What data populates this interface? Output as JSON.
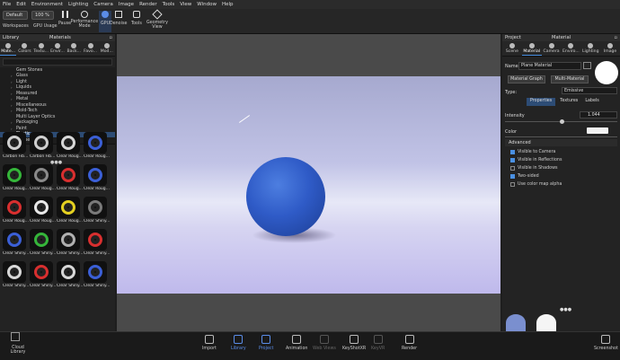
{
  "menu": [
    "File",
    "Edit",
    "Environment",
    "Lighting",
    "Camera",
    "Image",
    "Render",
    "Tools",
    "View",
    "Window",
    "Help"
  ],
  "toolbar": {
    "workspace": "Default",
    "zoom": "100 %",
    "labels": {
      "workspaces": "Workspaces",
      "gpu_usage": "GPU Usage",
      "pause": "Pause",
      "performance": "Performance Mode",
      "gpu": "GPU",
      "denoise": "Denoise",
      "tools": "Tools",
      "geometry": "Geometry View"
    }
  },
  "library": {
    "title": "Library",
    "section": "Materials",
    "tabs": [
      "Mate...",
      "Colors",
      "Textu...",
      "Envir...",
      "Back...",
      "Favo...",
      "Mod..."
    ],
    "tree": [
      {
        "label": "Gem Stones",
        "caret": ""
      },
      {
        "label": "Glass",
        "caret": "›"
      },
      {
        "label": "Light",
        "caret": "›"
      },
      {
        "label": "Liquids",
        "caret": "›"
      },
      {
        "label": "Measured",
        "caret": "›"
      },
      {
        "label": "Metal",
        "caret": "›"
      },
      {
        "label": "Miscellaneous",
        "caret": "›"
      },
      {
        "label": "Mold-Tech",
        "caret": "›"
      },
      {
        "label": "Multi Layer Optics",
        "caret": ""
      },
      {
        "label": "Packaging",
        "caret": "›"
      },
      {
        "label": "Paint",
        "caret": "›"
      },
      {
        "label": "Plastic",
        "caret": "›"
      },
      {
        "label": "Rubber",
        "caret": "›"
      }
    ],
    "selected_tree": "Plastic",
    "materials": [
      {
        "label": "Carbon Fib...",
        "color": "#cfcfcf"
      },
      {
        "label": "Carbon Fib...",
        "color": "#cfcfcf"
      },
      {
        "label": "Clear Roug...",
        "color": "#d8d8d8"
      },
      {
        "label": "Clear Roug...",
        "color": "#3b5fd6"
      },
      {
        "label": "Clear Roug...",
        "color": "#35b53a"
      },
      {
        "label": "Clear Roug...",
        "color": "#8a8a8a"
      },
      {
        "label": "Clear Roug...",
        "color": "#d82f2f"
      },
      {
        "label": "Clear Roug...",
        "color": "#3b5fd6"
      },
      {
        "label": "Clear Roug...",
        "color": "#d82f2f"
      },
      {
        "label": "Clear Roug...",
        "color": "#e8e8e8"
      },
      {
        "label": "Clear Roug...",
        "color": "#e4d021"
      },
      {
        "label": "Clear Shiny...",
        "color": "#7a7a7a"
      },
      {
        "label": "Clear Shiny...",
        "color": "#3b5fd6"
      },
      {
        "label": "Clear Shiny...",
        "color": "#35b53a"
      },
      {
        "label": "Clear Shiny...",
        "color": "#b0b0b0"
      },
      {
        "label": "Clear Shiny...",
        "color": "#d82f2f"
      },
      {
        "label": "Clear Shiny...",
        "color": "#d8d8d8"
      },
      {
        "label": "Clear Shiny...",
        "color": "#d82f2f"
      },
      {
        "label": "Clear Shiny...",
        "color": "#d8d8d8"
      },
      {
        "label": "Clear Shiny...",
        "color": "#3b5fd6"
      }
    ]
  },
  "project": {
    "title": "Project",
    "section": "Material",
    "tabs": [
      "Scene",
      "Material",
      "Camera",
      "Enviro...",
      "Lighting",
      "Image"
    ],
    "name_label": "Name",
    "name_value": "Plane Material",
    "btn_graph": "Material Graph",
    "btn_multi": "Multi-Material",
    "type_label": "Type:",
    "type_value": "Emissive",
    "subtabs": [
      "Properties",
      "Textures",
      "Labels"
    ],
    "intensity_label": "Intensity",
    "intensity_value": "1.044",
    "color_label": "Color",
    "advanced_label": "Advanced",
    "options": [
      {
        "label": "Visible to Camera",
        "checked": true
      },
      {
        "label": "Visible in Reflections",
        "checked": true
      },
      {
        "label": "Visible in Shadows",
        "checked": false
      },
      {
        "label": "Two-sided",
        "checked": true
      },
      {
        "label": "Use color map alpha",
        "checked": false
      }
    ]
  },
  "bottom": {
    "cloud": "Cloud Library",
    "items": [
      "Import",
      "Library",
      "Project",
      "Animation",
      "Web Views",
      "KeyShotXR",
      "KeyVR",
      "Render"
    ],
    "screenshot": "Screenshot"
  },
  "colors": {
    "accent": "#4a90e2",
    "sphere": "#2f5bc7"
  }
}
